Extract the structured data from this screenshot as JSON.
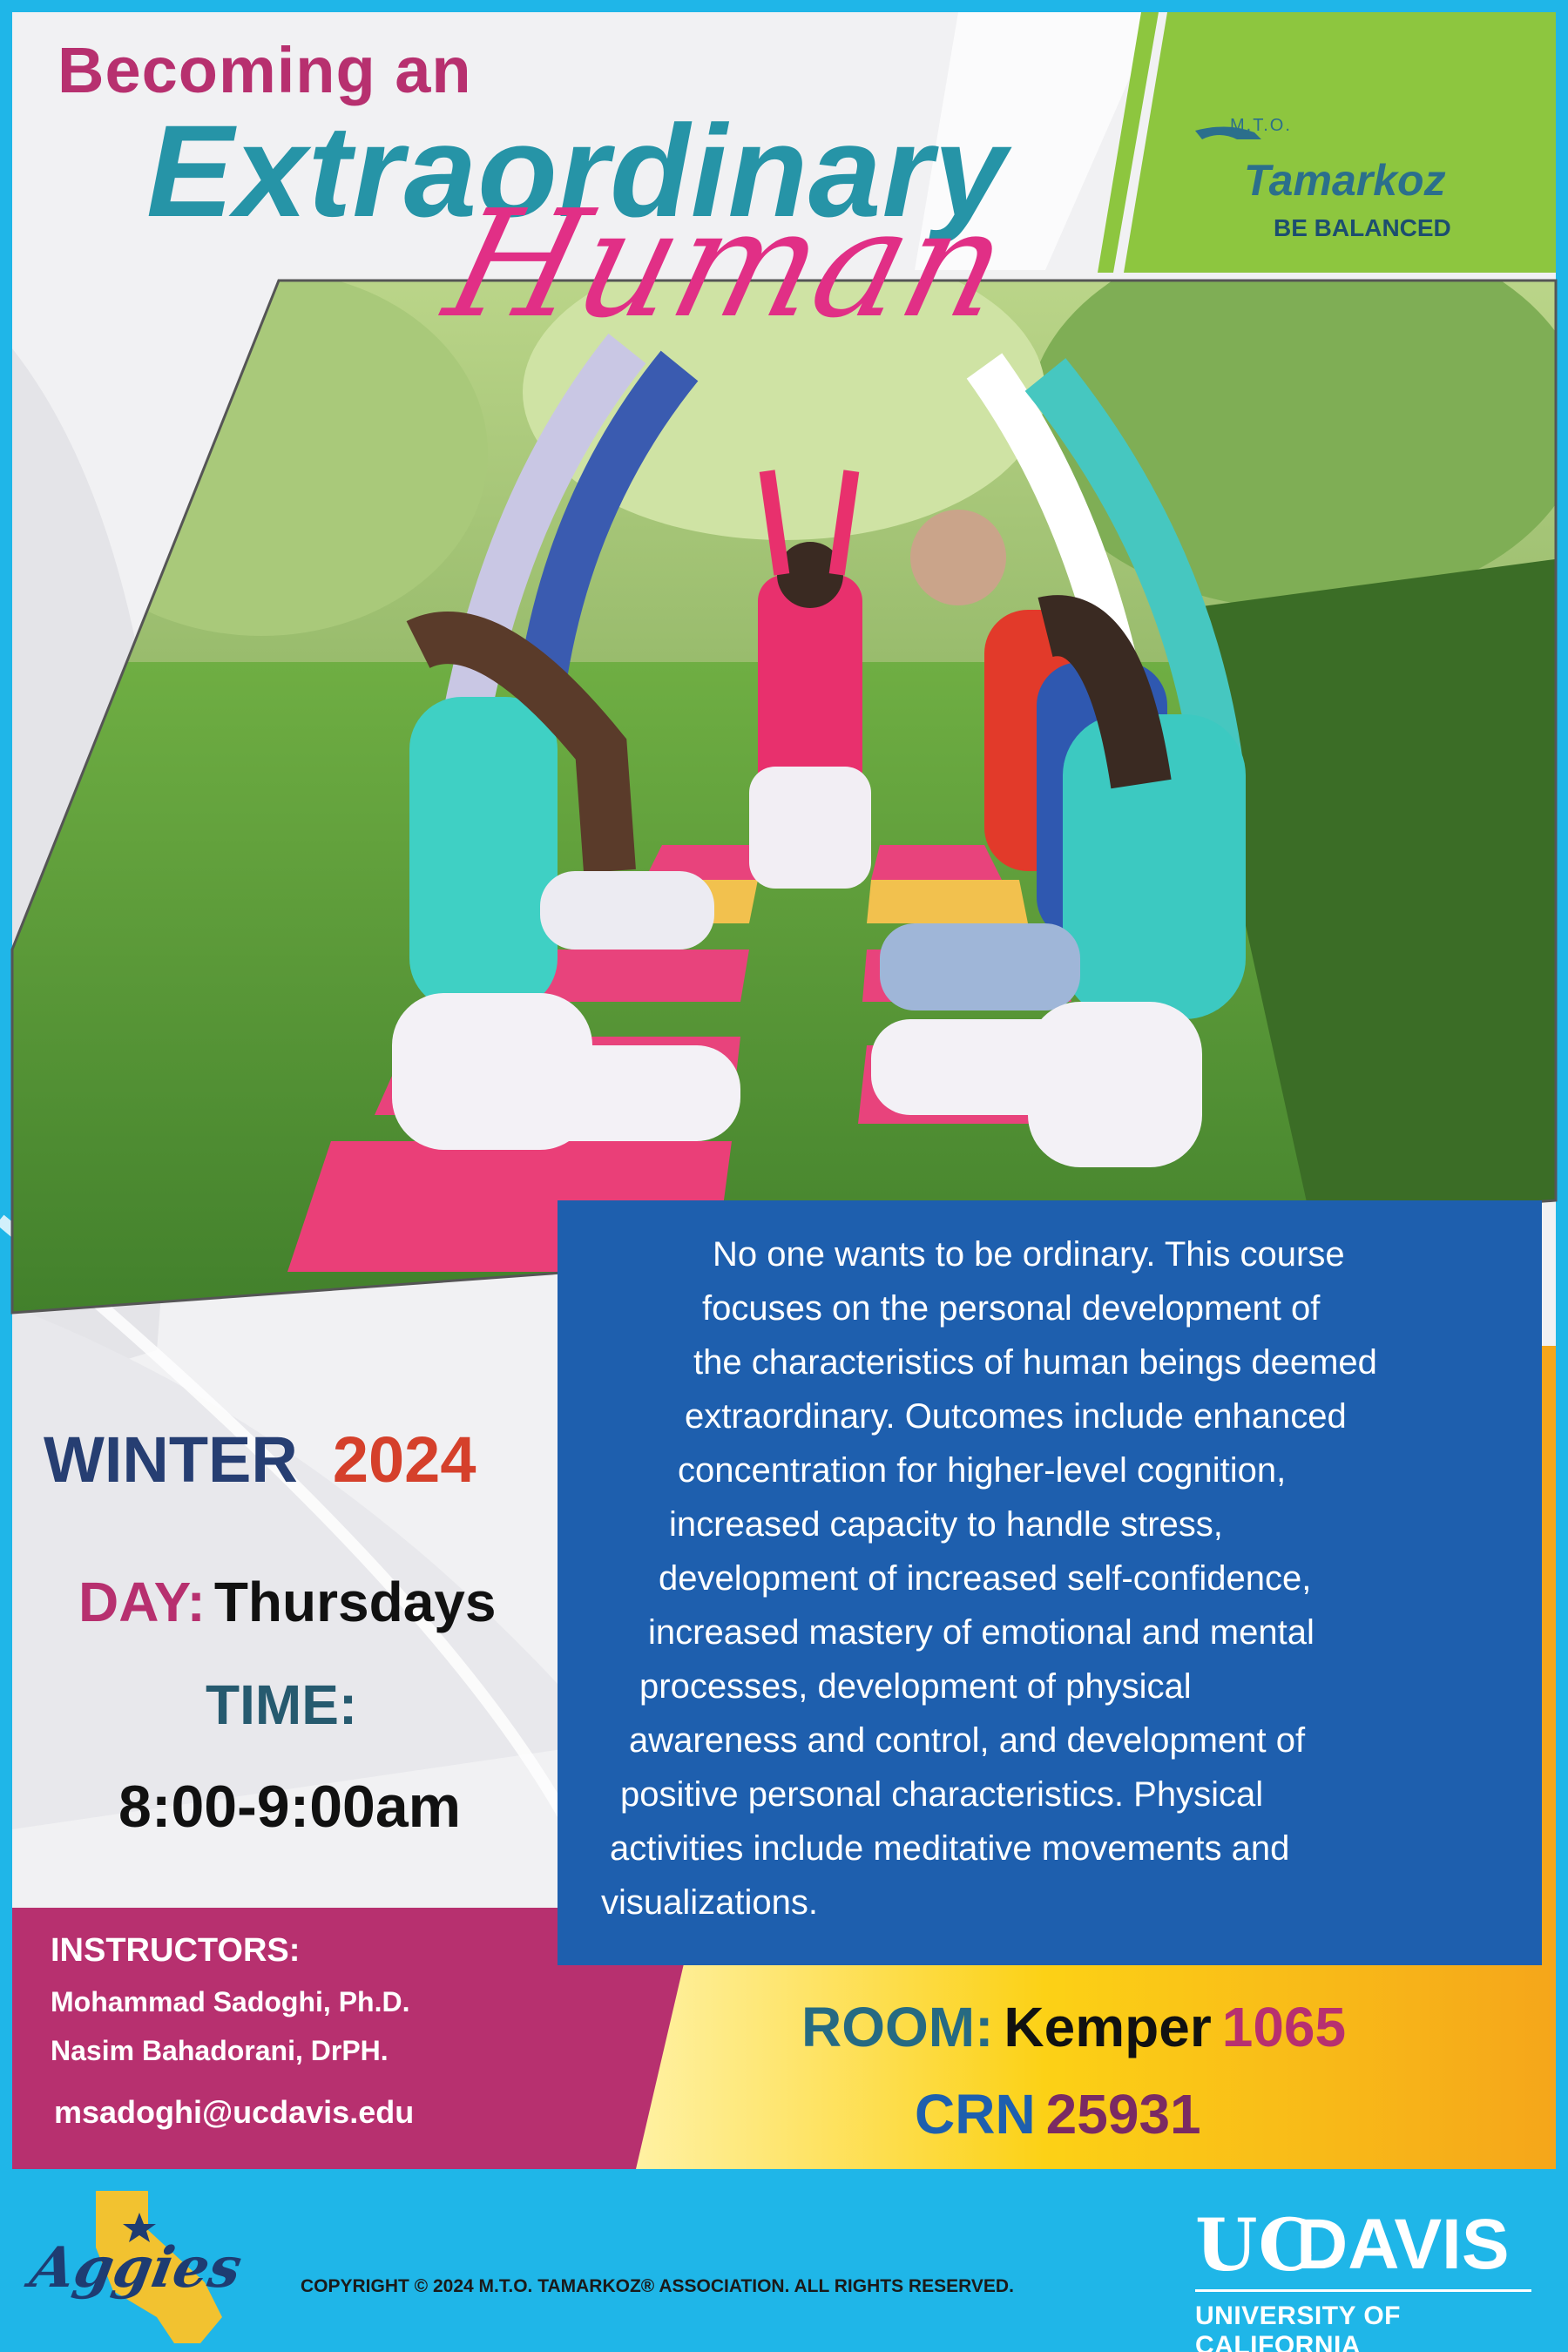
{
  "title": {
    "line1": "Becoming an",
    "line2": "Extraordinary",
    "line3": "Human"
  },
  "logo": {
    "prefix": "M.T.O.",
    "brand": "Tamarkoz",
    "tagline": "BE BALANCED"
  },
  "description_lines": [
    "No one wants to be ordinary. This course",
    "focuses on the personal development of",
    "the characteristics of human beings deemed",
    "extraordinary. Outcomes include enhanced",
    "concentration for higher-level cognition,",
    "increased capacity to handle stress,",
    "development of increased self-confidence,",
    "increased mastery of emotional and mental",
    "processes, development of physical",
    "awareness and control, and development of",
    "positive personal characteristics. Physical",
    "activities include meditative movements and",
    "visualizations."
  ],
  "schedule": {
    "term": "WINTER",
    "year": "2024",
    "day_label": "DAY:",
    "day_value": "Thursdays",
    "time_label": "TIME:",
    "time_value": "8:00-9:00am"
  },
  "instructors": {
    "heading": "INSTRUCTORS:",
    "names": [
      "Mohammad Sadoghi, Ph.D.",
      "Nasim Bahadorani, DrPH."
    ],
    "email": "msadoghi@ucdavis.edu"
  },
  "room": {
    "label": "ROOM:",
    "building": "Kemper",
    "number": "1065",
    "crn_label": "CRN",
    "crn_number": "25931"
  },
  "footer": {
    "aggies": "Aggies",
    "copyright": "COPYRIGHT © 2024 M.T.O. TAMARKOZ®  ASSOCIATION.  ALL RIGHTS RESERVED.",
    "uc": "UC",
    "davis": "DAVIS",
    "university": "UNIVERSITY OF CALIFORNIA"
  },
  "colors": {
    "frame": "#1fb6e8",
    "green": "#8dc63f",
    "blue_box": "#1e5fae",
    "magenta": "#b7306f",
    "yellow": "#fcd116",
    "orange": "#f5a61a",
    "teal_title": "#2694a7",
    "pink_script": "#e12f86"
  }
}
